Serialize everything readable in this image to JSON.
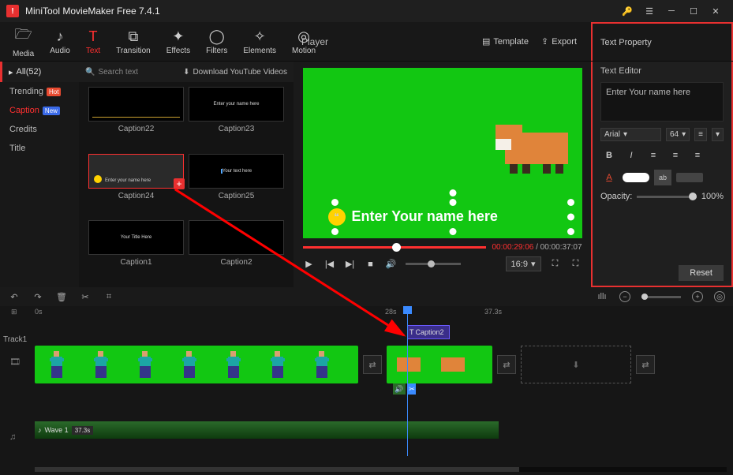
{
  "app": {
    "title": "MiniTool MovieMaker Free 7.4.1"
  },
  "toolbar": {
    "items": [
      "Media",
      "Audio",
      "Text",
      "Transition",
      "Effects",
      "Filters",
      "Elements",
      "Motion"
    ],
    "active": 2
  },
  "playerHeader": {
    "label": "Player",
    "template": "Template",
    "export": "Export"
  },
  "textProperty": {
    "title": "Text Property"
  },
  "sidebar": {
    "all": "All(52)",
    "items": [
      {
        "label": "Trending",
        "badge": "Hot"
      },
      {
        "label": "Caption",
        "badge": "New",
        "active": true
      },
      {
        "label": "Credits"
      },
      {
        "label": "Title"
      }
    ]
  },
  "library": {
    "searchPlaceholder": "Search text",
    "download": "Download YouTube Videos",
    "thumbs": [
      {
        "label": "Caption22",
        "preview": ""
      },
      {
        "label": "Caption23",
        "preview": "Enter your name here"
      },
      {
        "label": "Caption24",
        "preview": "Enter your name here",
        "selected": true,
        "add": true
      },
      {
        "label": "Caption25",
        "preview": "Your text here"
      },
      {
        "label": "Caption1",
        "preview": "Your Title Here"
      },
      {
        "label": "Caption2",
        "preview": ""
      }
    ]
  },
  "player": {
    "overlayText": "Enter Your name here",
    "current": "00:00:29:06",
    "duration": "00:00:37:07",
    "aspect": "16:9"
  },
  "textEditor": {
    "label": "Text Editor",
    "value": "Enter Your name here",
    "font": "Arial",
    "size": "64",
    "opacityLabel": "Opacity:",
    "opacityValue": "100%",
    "reset": "Reset"
  },
  "timeline": {
    "ticks": [
      "0s",
      "28s",
      "37.3s"
    ],
    "track1": "Track1",
    "captionClip": "Caption2",
    "audioClip": {
      "name": "Wave 1",
      "dur": "37.3s"
    }
  }
}
